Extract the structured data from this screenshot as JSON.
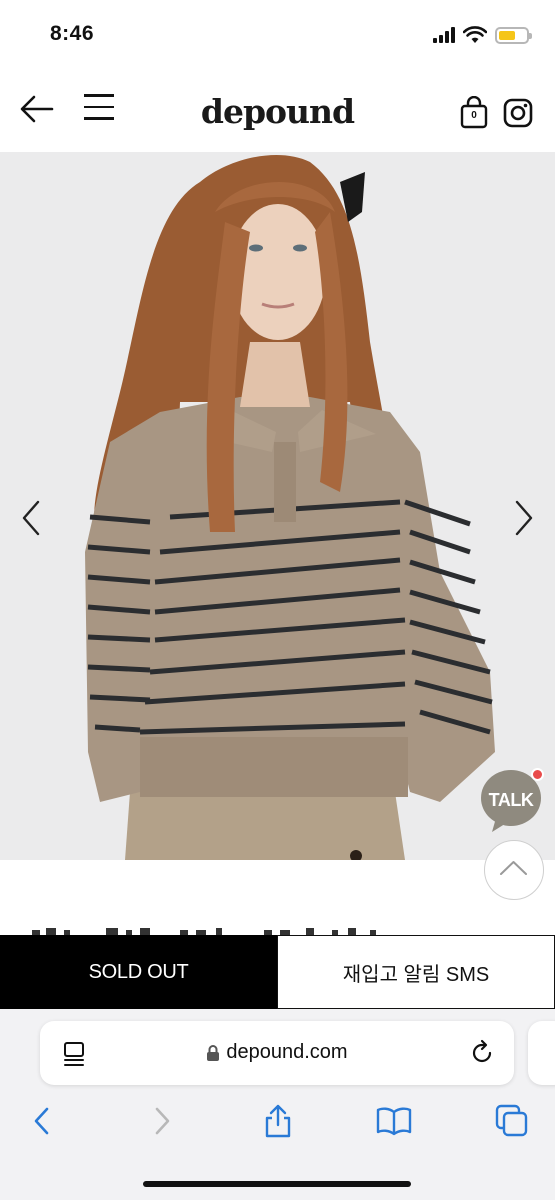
{
  "status_bar": {
    "time": "8:46",
    "battery_level": 0.6,
    "battery_color": "#f5c518"
  },
  "header": {
    "logo": "depound",
    "cart_count": "0",
    "icons": [
      "back-arrow-icon",
      "menu-icon",
      "shopping-bag-icon",
      "instagram-icon"
    ]
  },
  "product": {
    "carousel_prev_icon": "chevron-left-icon",
    "carousel_next_icon": "chevron-right-icon",
    "image_colors": {
      "sweater": "#a89683",
      "stripe": "#2b2d30",
      "hair": "#a8683e",
      "background": "#ebebec"
    }
  },
  "floating": {
    "talk_label": "TALK",
    "talk_color": "#8f8a7f",
    "notification_color": "#e94b4b"
  },
  "actions": {
    "sold_out_label": "SOLD OUT",
    "restock_label": "재입고 알림 SMS"
  },
  "browser": {
    "url": "depound.com"
  }
}
